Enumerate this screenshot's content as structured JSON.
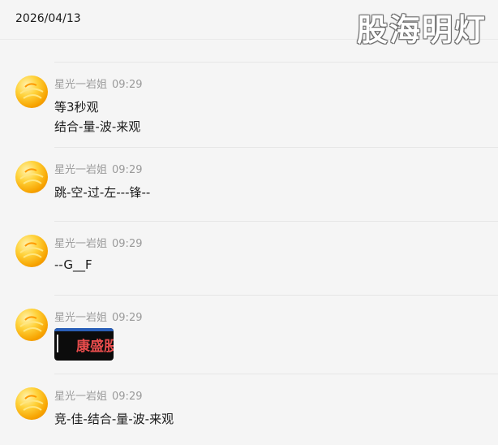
{
  "date": "2026/04/13",
  "watermark": "股海明灯",
  "messages": [
    {
      "sender": "星光一岩姐",
      "time": "09:29",
      "lines": [
        "等3秒观",
        "结合-量-波-来观"
      ]
    },
    {
      "sender": "星光一岩姐",
      "time": "09:29",
      "lines": [
        "跳-空-过-左---锋--"
      ]
    },
    {
      "sender": "星光一岩姐",
      "time": "09:29",
      "lines": [
        "--G__F"
      ]
    },
    {
      "sender": "星光一岩姐",
      "time": "09:29",
      "image_text": "康盛股"
    },
    {
      "sender": "星光一岩姐",
      "time": "09:29",
      "lines": [
        "竞-佳-结合-量-波-来观"
      ]
    }
  ]
}
